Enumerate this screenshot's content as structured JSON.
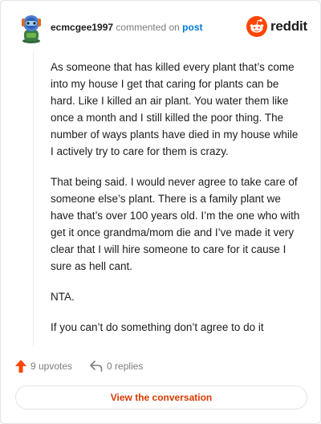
{
  "header": {
    "username": "ecmcgee1997",
    "action_text": "commented on",
    "target_link": "post",
    "brand_name": "reddit"
  },
  "comment": {
    "paragraphs": [
      "As someone that has killed every plant that’s come into my house I get that caring for plants can be hard. Like I killed an air plant. You water them like once a month and I still killed the poor thing. The number of ways plants have died in my house while I actively try to care for them is crazy.",
      "That being said. I would never agree to take care of someone else’s plant. There is a family plant we have that’s over 100 years old. I’m the one who with get it once grandma/mom die and I’ve made it very clear that I will hire someone to care for it cause I sure as hell cant.",
      "NTA.",
      "If you can’t do something don’t agree to do it"
    ]
  },
  "actions": {
    "upvotes_label": "9 upvotes",
    "replies_label": "0 replies"
  },
  "cta": {
    "label": "View the conversation"
  },
  "colors": {
    "brand_orange": "#ff4500",
    "link_blue": "#0079d3",
    "cta_text": "#d93a00",
    "upvote_arrow": "#ff4500"
  },
  "icons": {
    "avatar": "snoo-avatar-icon",
    "brand": "reddit-logo-icon",
    "upvote": "upvote-arrow-icon",
    "reply": "reply-arrow-icon"
  }
}
